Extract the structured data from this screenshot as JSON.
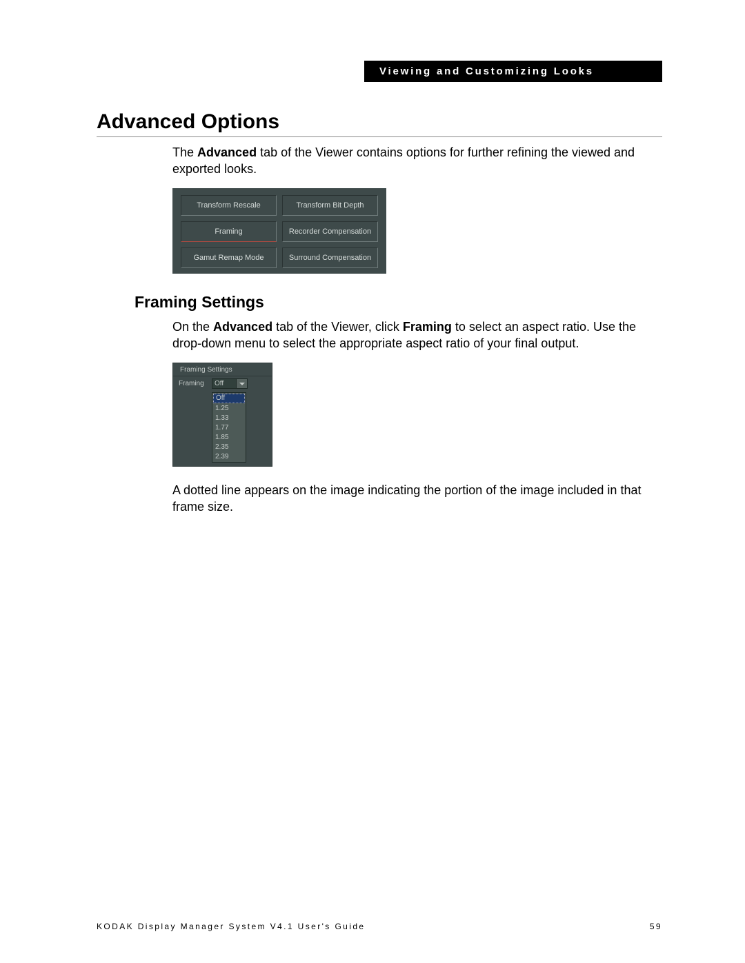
{
  "header": {
    "section_title": "Viewing and Customizing Looks"
  },
  "h1": "Advanced Options",
  "intro": {
    "pre": "The ",
    "bold1": "Advanced",
    "post": " tab of the Viewer contains options for further refining the viewed and exported looks."
  },
  "adv_panel": {
    "buttons": [
      [
        "Transform Rescale",
        "Transform Bit Depth"
      ],
      [
        "Framing",
        "Recorder Compensation"
      ],
      [
        "Gamut Remap Mode",
        "Surround Compensation"
      ]
    ]
  },
  "h2": "Framing Settings",
  "framing_para": {
    "p1": "On the ",
    "b1": "Advanced",
    "p2": " tab of the Viewer, click ",
    "b2": "Framing",
    "p3": " to select an aspect ratio. Use the drop-down menu to select the appropriate aspect ratio of your final output."
  },
  "framing_ui": {
    "group_title": "Framing Settings",
    "label": "Framing",
    "selected": "Off",
    "options": [
      "Off",
      "1.25",
      "1.33",
      "1.77",
      "1.85",
      "2.35",
      "2.39"
    ]
  },
  "after_framing": "A dotted line appears on the image indicating the portion of the image included in that frame size.",
  "footer": {
    "left": "KODAK Display Manager System V4.1 User's Guide",
    "right": "59"
  }
}
